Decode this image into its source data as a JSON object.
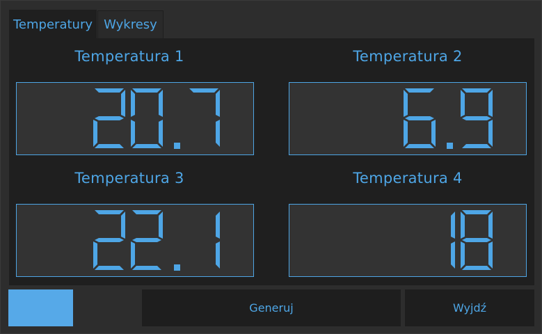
{
  "tabs": {
    "active": "Temperatury",
    "inactive": "Wykresy"
  },
  "sensors": [
    {
      "label": "Temperatura 1",
      "value": "20.7"
    },
    {
      "label": "Temperatura 2",
      "value": "6.9"
    },
    {
      "label": "Temperatura 3",
      "value": "22.1"
    },
    {
      "label": "Temperatura 4",
      "value": "18"
    }
  ],
  "buttons": {
    "generate": "Generuj",
    "exit": "Wyjdź"
  },
  "colors": {
    "accent": "#4ea6e6",
    "swatch": "#56a9e8",
    "panel": "#1f1f1f",
    "lcd_bg": "#333333"
  }
}
